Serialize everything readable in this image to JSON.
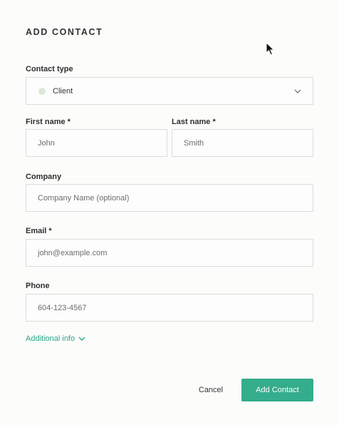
{
  "dialog": {
    "title": "ADD CONTACT"
  },
  "contact_type": {
    "label": "Contact type",
    "selected": "Client",
    "dot_color": "#dbe9d6"
  },
  "first_name": {
    "label": "First name *",
    "placeholder": "John"
  },
  "last_name": {
    "label": "Last name *",
    "placeholder": "Smith"
  },
  "company": {
    "label": "Company",
    "placeholder": "Company Name (optional)"
  },
  "email": {
    "label": "Email *",
    "placeholder": "john@example.com"
  },
  "phone": {
    "label": "Phone",
    "placeholder": "604-123-4567"
  },
  "additional_info": {
    "label": "Additional info",
    "icon": "chevron-down-icon"
  },
  "actions": {
    "cancel_label": "Cancel",
    "submit_label": "Add Contact"
  },
  "colors": {
    "accent": "#34ad8c",
    "link": "#2aa58a",
    "border": "#dcdcdc"
  }
}
